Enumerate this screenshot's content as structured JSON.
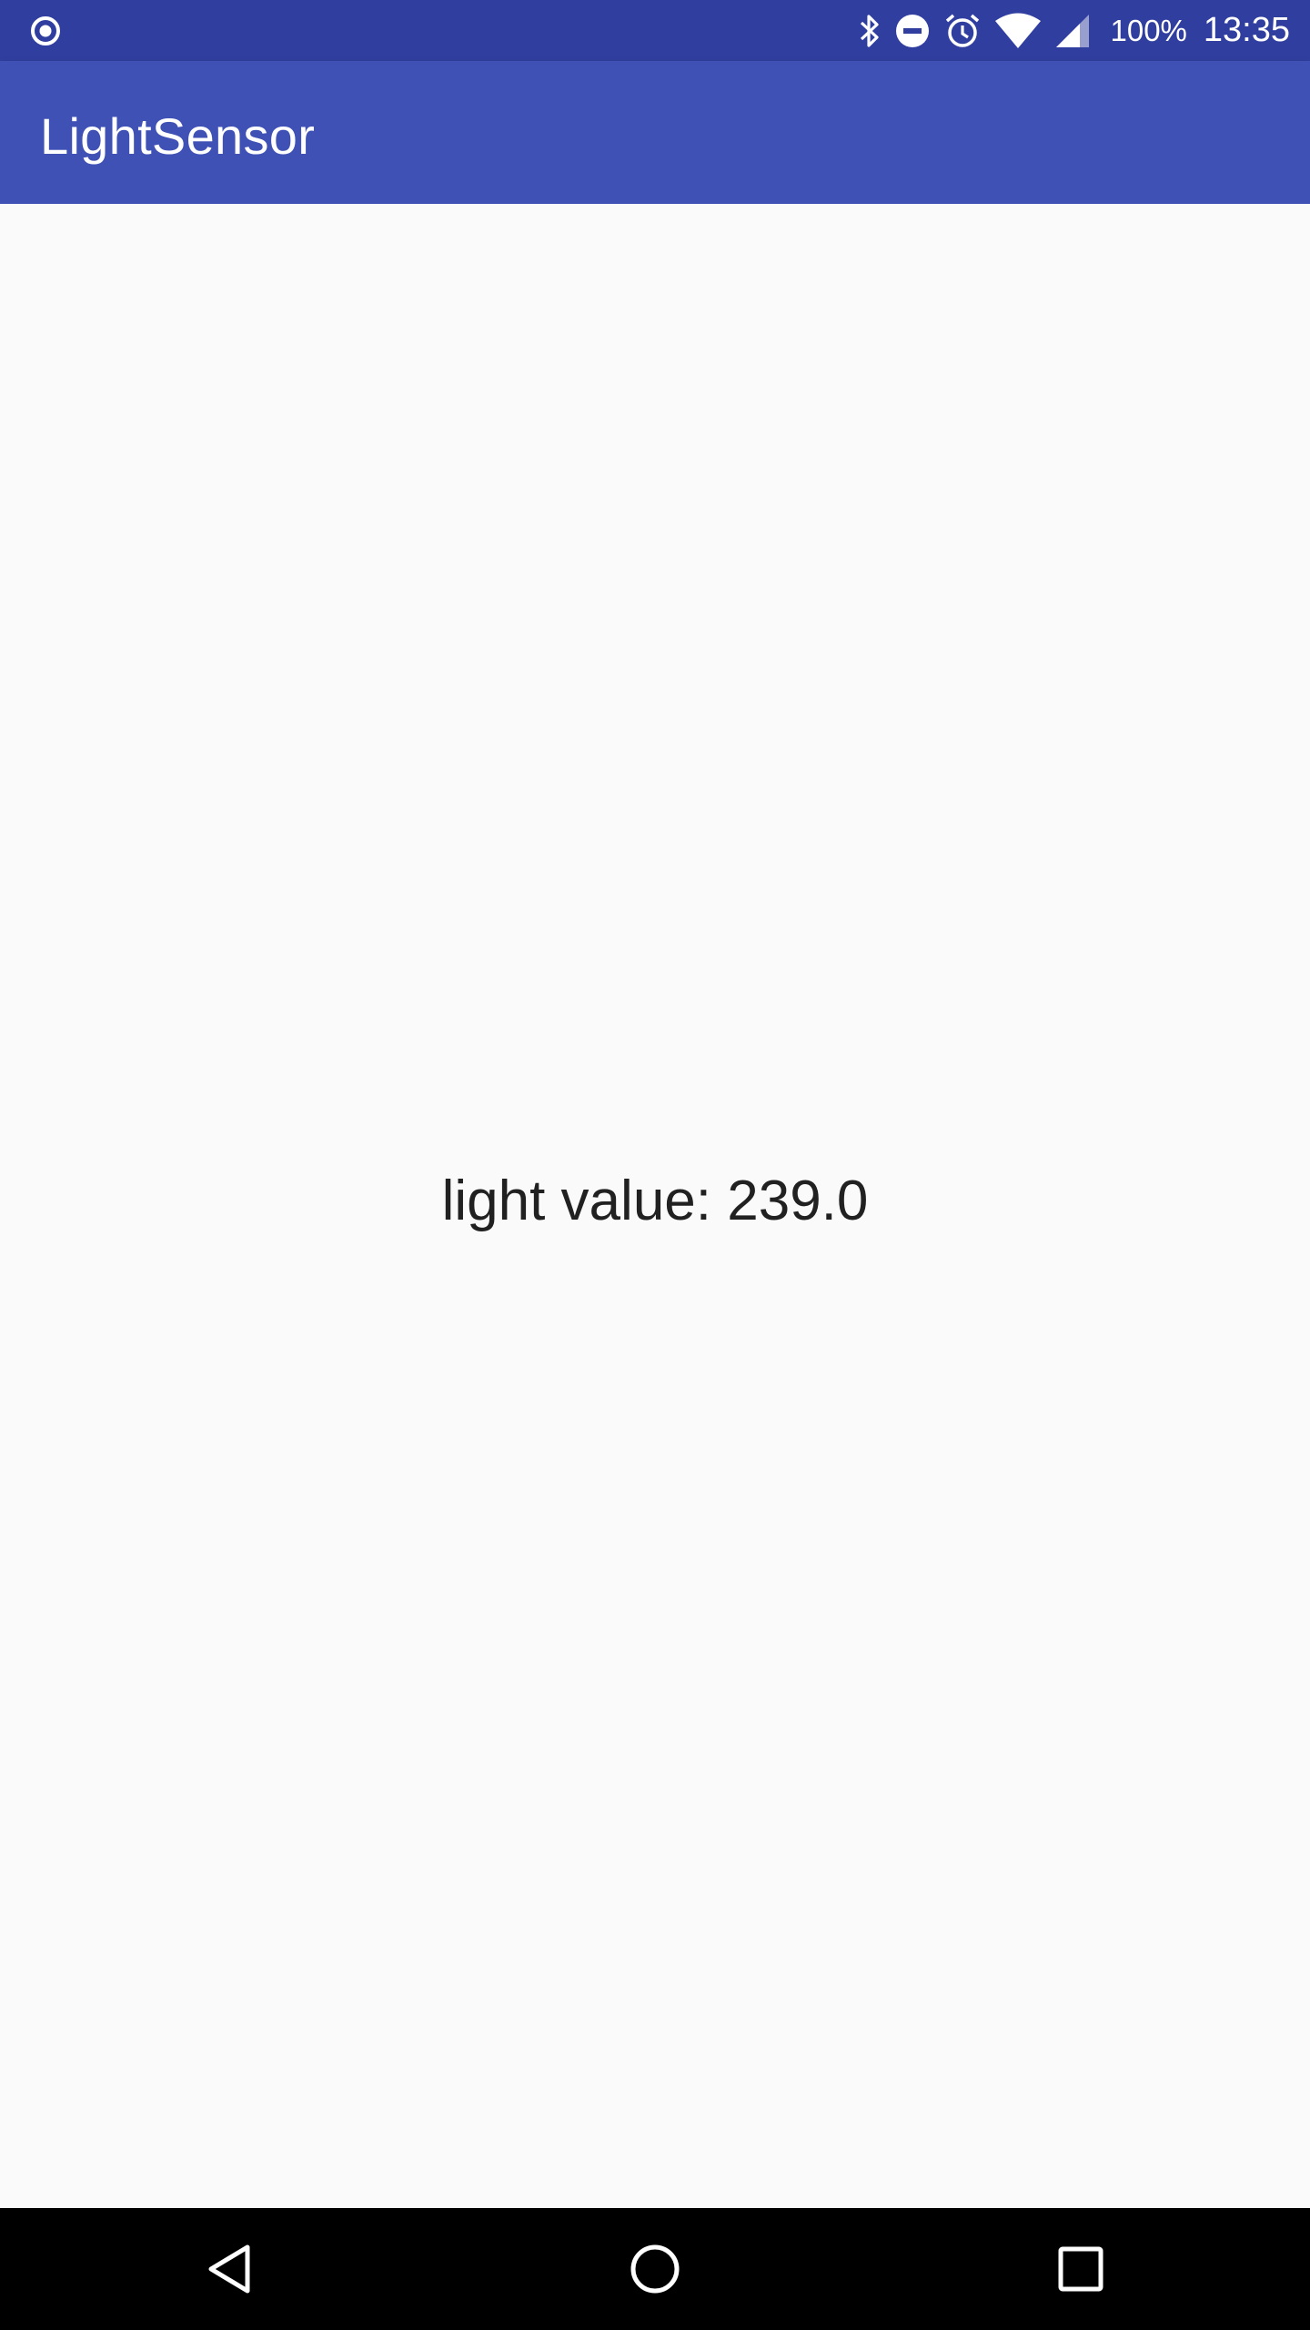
{
  "status_bar": {
    "left_icon": "record-icon",
    "icons": [
      "bluetooth-icon",
      "do-not-disturb-icon",
      "alarm-icon",
      "wifi-icon",
      "cell-signal-icon"
    ],
    "battery": "100%",
    "time": "13:35"
  },
  "app_bar": {
    "title": "LightSensor"
  },
  "main": {
    "light_value_text": "light value: 239.0"
  },
  "nav_bar": {
    "icons": [
      "back-icon",
      "home-icon",
      "recents-icon"
    ]
  },
  "colors": {
    "status_bar": "#303f9f",
    "app_bar": "#3f51b5",
    "background": "#fafafa",
    "text": "#212121",
    "nav_bar": "#000000"
  }
}
